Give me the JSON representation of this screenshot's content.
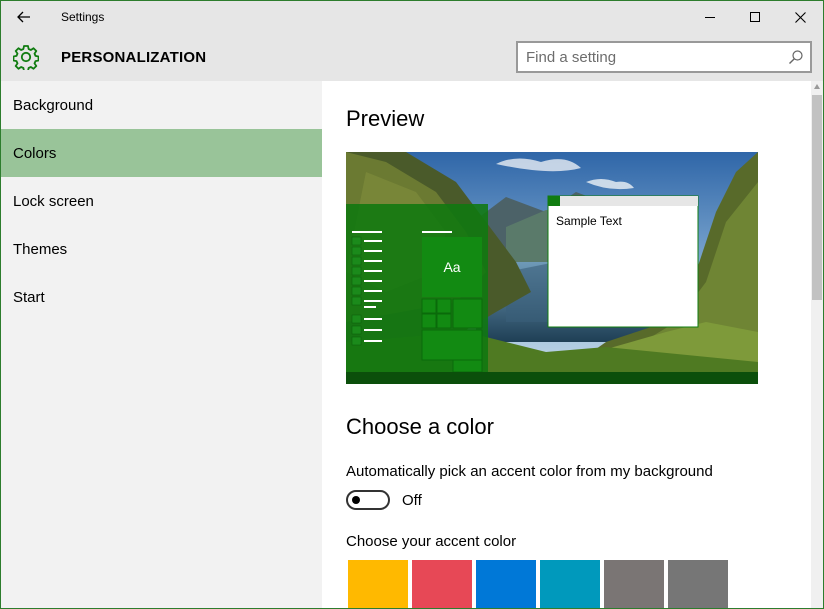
{
  "titlebar": {
    "title": "Settings",
    "back_icon": "back-arrow-icon",
    "minimize_icon": "minimize-icon",
    "maximize_icon": "maximize-icon",
    "close_icon": "close-icon"
  },
  "header": {
    "icon": "gear-icon",
    "title": "PERSONALIZATION",
    "accent_color": "#107c10",
    "search": {
      "placeholder": "Find a setting",
      "value": "",
      "icon": "search-icon"
    }
  },
  "sidebar": {
    "items": [
      {
        "label": "Background",
        "active": false
      },
      {
        "label": "Colors",
        "active": true
      },
      {
        "label": "Lock screen",
        "active": false
      },
      {
        "label": "Themes",
        "active": false
      },
      {
        "label": "Start",
        "active": false
      }
    ],
    "active_color": "#99c499"
  },
  "main": {
    "preview_heading": "Preview",
    "preview": {
      "sample_text": "Sample Text",
      "tile_text": "Aa",
      "accent_color": "#107c10"
    },
    "choose_heading": "Choose a color",
    "auto_label": "Automatically pick an accent color from my background",
    "toggle_state": "Off",
    "toggle_on": false,
    "accent_label": "Choose your accent color",
    "swatches": [
      "#ffb900",
      "#e74856",
      "#0078d7",
      "#0099bc",
      "#7a7574",
      "#767676"
    ]
  }
}
